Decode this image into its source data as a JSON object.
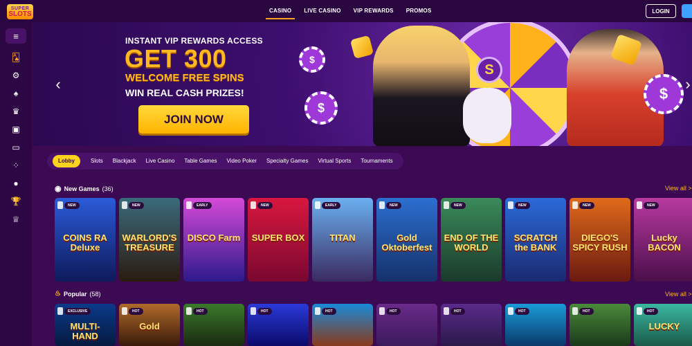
{
  "brand": {
    "logo_top": "SUPER",
    "logo_bottom": "SLOTS"
  },
  "topnav": {
    "items": [
      "CASINO",
      "LIVE CASINO",
      "VIP REWARDS",
      "PROMOS"
    ],
    "active": "CASINO"
  },
  "auth": {
    "login": "LOGIN"
  },
  "sidebar": {
    "menu_icon": "hamburger-icon",
    "items": [
      {
        "name": "sidebar-item-lobby",
        "icon": "🂡",
        "active": true
      },
      {
        "name": "sidebar-item-slots",
        "icon": "⚙",
        "active": false
      },
      {
        "name": "sidebar-item-table-games",
        "icon": "♠",
        "active": false
      },
      {
        "name": "sidebar-item-live-casino",
        "icon": "♛",
        "active": false
      },
      {
        "name": "sidebar-item-video-poker",
        "icon": "▣",
        "active": false
      },
      {
        "name": "sidebar-item-virtual-sports",
        "icon": "▭",
        "active": false
      },
      {
        "name": "sidebar-item-specialty",
        "icon": "⁘",
        "active": false
      },
      {
        "name": "sidebar-item-sports",
        "icon": "●",
        "active": false
      },
      {
        "name": "sidebar-item-tournaments",
        "icon": "🏆",
        "active": false
      },
      {
        "name": "sidebar-item-vip",
        "icon": "♕",
        "active": false
      }
    ]
  },
  "hero": {
    "line1": "INSTANT VIP REWARDS ACCESS",
    "line2": "GET 300",
    "line3": "WELCOME FREE SPINS",
    "line4": "WIN REAL CASH PRIZES!",
    "cta": "JOIN NOW",
    "prev": "‹",
    "next": "›",
    "wheel_symbol": "S"
  },
  "categories": [
    "Lobby",
    "Slots",
    "Blackjack",
    "Live Casino",
    "Table Games",
    "Video Poker",
    "Specialty Games",
    "Virtual Sports",
    "Tournaments"
  ],
  "new_games": {
    "title": "New Games",
    "count": "(36)",
    "view_all": "View all >",
    "tiles": [
      {
        "badge": "NEW",
        "name": "COINS RA Deluxe",
        "colors": [
          "#2a5bd8",
          "#0e1a5a"
        ]
      },
      {
        "badge": "NEW",
        "name": "WARLORD'S TREASURE",
        "colors": [
          "#3b6b7a",
          "#2a1a10"
        ]
      },
      {
        "badge": "EARLY",
        "name": "DISCO Farm",
        "colors": [
          "#d54ad8",
          "#2d1a8a"
        ]
      },
      {
        "badge": "NEW",
        "name": "SUPER BOX",
        "colors": [
          "#d8173e",
          "#7a0830"
        ]
      },
      {
        "badge": "EARLY",
        "name": "TITAN",
        "colors": [
          "#6ab0f0",
          "#3a2a60"
        ]
      },
      {
        "badge": "NEW",
        "name": "Gold Oktoberfest",
        "colors": [
          "#2c6fd0",
          "#15306a"
        ]
      },
      {
        "badge": "NEW",
        "name": "END OF THE WORLD",
        "colors": [
          "#3a8a5a",
          "#1a3a2a"
        ]
      },
      {
        "badge": "NEW",
        "name": "SCRATCH the BANK",
        "colors": [
          "#2a6ad8",
          "#1a2a70"
        ]
      },
      {
        "badge": "NEW",
        "name": "DIEGO'S SPICY RUSH",
        "colors": [
          "#e06a1a",
          "#6a1a10"
        ]
      },
      {
        "badge": "NEW",
        "name": "Lucky BACON",
        "colors": [
          "#b83aa0",
          "#4a0e4a"
        ]
      }
    ]
  },
  "popular": {
    "title": "Popular",
    "count": "(58)",
    "view_all": "View all >",
    "tiles": [
      {
        "badge": "EXCLUSIVE",
        "name": "MULTI-HAND",
        "colors": [
          "#0a3a8a",
          "#061a40"
        ]
      },
      {
        "badge": "HOT",
        "name": "Gold",
        "colors": [
          "#b06a2a",
          "#3a1a0a"
        ]
      },
      {
        "badge": "HOT",
        "name": "",
        "colors": [
          "#3a7a2a",
          "#1a2a10"
        ]
      },
      {
        "badge": "HOT",
        "name": "",
        "colors": [
          "#2a3ad8",
          "#0a0a6a"
        ]
      },
      {
        "badge": "HOT",
        "name": "",
        "colors": [
          "#1a8ad8",
          "#8a3a1a"
        ]
      },
      {
        "badge": "HOT",
        "name": "",
        "colors": [
          "#6a2a8a",
          "#3a1a5a"
        ]
      },
      {
        "badge": "HOT",
        "name": "",
        "colors": [
          "#5a2a8a",
          "#2a1a4a"
        ]
      },
      {
        "badge": "HOT",
        "name": "",
        "colors": [
          "#1a9ad8",
          "#0a3a6a"
        ]
      },
      {
        "badge": "HOT",
        "name": "",
        "colors": [
          "#4a8a3a",
          "#1a3a1a"
        ]
      },
      {
        "badge": "HOT",
        "name": "LUCKY",
        "colors": [
          "#3ab8a0",
          "#1a5a4a"
        ]
      }
    ]
  },
  "colors": {
    "accent": "#ffb81f",
    "bg": "#3b0a52",
    "sidebar": "#2d0744",
    "topbar": "#2a0640"
  }
}
